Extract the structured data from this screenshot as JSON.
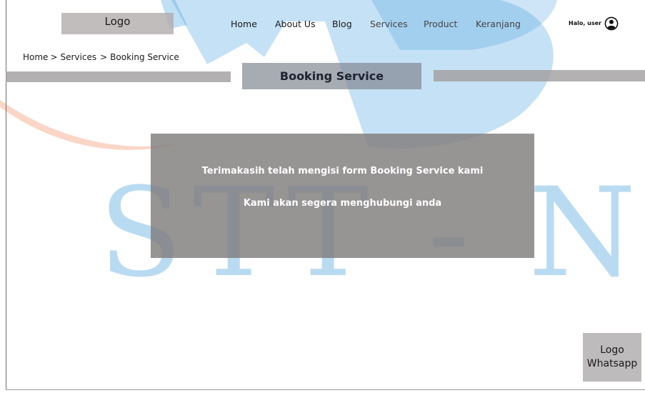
{
  "header": {
    "logo_label": "Logo",
    "nav": [
      {
        "label": "Home"
      },
      {
        "label": "About Us"
      },
      {
        "label": "Blog"
      },
      {
        "label": "Services"
      },
      {
        "label": "Product"
      },
      {
        "label": "Keranjang"
      }
    ],
    "user_greeting": "Halo, user",
    "user_icon": "user-circle-icon"
  },
  "breadcrumb": {
    "items": [
      "Home",
      "Services",
      "Booking Service"
    ],
    "separator": ">"
  },
  "page_title": "Booking Service",
  "message": {
    "line1": "Terimakasih telah mengisi form Booking Service kami",
    "line2": "Kami akan segera menghubungi anda"
  },
  "whatsapp": {
    "line1": "Logo",
    "line2": "Whatsapp"
  },
  "watermark": {
    "text": "STT - NF",
    "color_blue": "#4aa3df",
    "color_orange": "#f4a582"
  }
}
